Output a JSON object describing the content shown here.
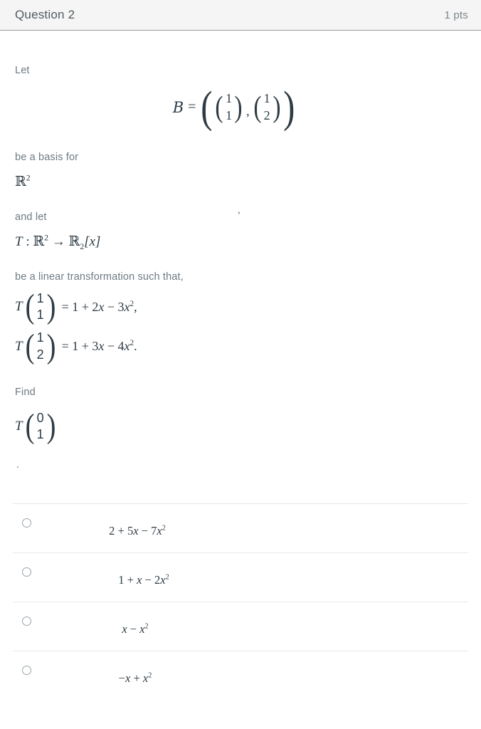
{
  "header": {
    "title": "Question 2",
    "points": "1 pts"
  },
  "question": {
    "line_let": "Let",
    "basis_equation": {
      "lhs": "B",
      "equals": "=",
      "vector1": [
        "1",
        "1"
      ],
      "separator": ",",
      "vector2": [
        "1",
        "2"
      ]
    },
    "stray_comma": ",",
    "line_be_a_basis_for": "be a basis for",
    "space_r2": {
      "symbol": "ℝ",
      "exponent": "2"
    },
    "line_and_let": "and let",
    "transformation_decl": {
      "t": "T",
      "colon": ":",
      "domain_symbol": "ℝ",
      "domain_exponent": "2",
      "arrow": "→",
      "codomain_symbol": "ℝ",
      "codomain_index": "2",
      "codomain_bracket": "[x]"
    },
    "line_be_linear": "be a linear transformation such that,",
    "given": [
      {
        "t": "T",
        "vector": [
          "1",
          "1"
        ],
        "rhs_prefix": "= 1 + 2",
        "rhs_mid": "x",
        "rhs_minus": " − 3",
        "rhs_var": "x",
        "rhs_exp": "2",
        "rhs_tail": ","
      },
      {
        "t": "T",
        "vector": [
          "1",
          "2"
        ],
        "rhs_prefix": "= 1 + 3",
        "rhs_mid": "x",
        "rhs_minus": " − 4",
        "rhs_var": "x",
        "rhs_exp": "2",
        "rhs_tail": "."
      }
    ],
    "line_find": "Find",
    "find_expression": {
      "t": "T",
      "vector": [
        "0",
        "1"
      ]
    },
    "trailing_period": "."
  },
  "answers": [
    {
      "id": "a",
      "text_prefix": "2 + 5",
      "var1": "x",
      "op": " − 7",
      "var2": "x",
      "exp": "2"
    },
    {
      "id": "b",
      "text_prefix": "1 + ",
      "var1": "x",
      "op": " − 2",
      "var2": "x",
      "exp": "2"
    },
    {
      "id": "c",
      "text_prefix": "",
      "var1": "x",
      "op": " − ",
      "var2": "x",
      "exp": "2"
    },
    {
      "id": "d",
      "text_prefix": "−",
      "var1": "x",
      "op": " + ",
      "var2": "x",
      "exp": "2"
    }
  ],
  "colors": {
    "header_bg": "#f5f5f5",
    "header_border": "#9a9a9a",
    "body_text": "#6d7a82",
    "math_text": "#2e3b44",
    "divider": "#e6e8ea",
    "radio_border": "#9aa3a8"
  }
}
